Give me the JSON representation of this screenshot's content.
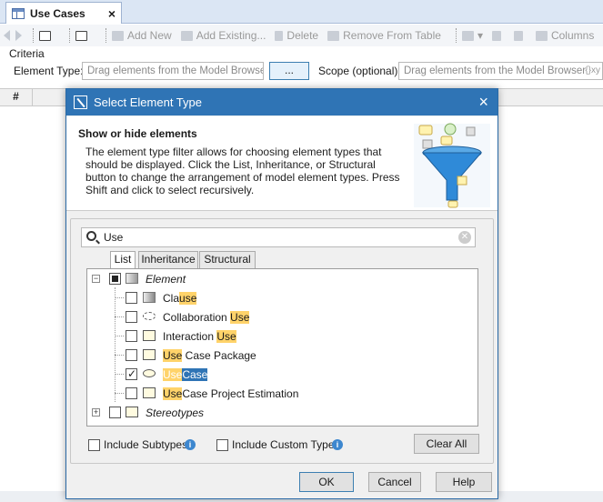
{
  "tab": {
    "title": "Use Cases",
    "close": "×"
  },
  "toolbar": {
    "add_new": "Add New",
    "add_existing": "Add Existing...",
    "delete": "Delete",
    "remove_from_table": "Remove From Table",
    "columns": "Columns"
  },
  "criteria": {
    "label": "Criteria",
    "element_type_label": "Element Type:",
    "element_type_placeholder": "Drag elements from the Model Browser",
    "browse_button": "...",
    "scope_label": "Scope (optional):",
    "scope_placeholder": "Drag elements from the Model Browser",
    "scope_suffix": "{}ху"
  },
  "table": {
    "hash_header": "#"
  },
  "dialog": {
    "title": "Select Element Type",
    "close": "×",
    "banner_title": "Show or hide elements",
    "banner_text": "The element type filter allows for choosing element types that should be displayed. Click the List, Inheritance, or Structural button to change the arrangement of model element types. Press Shift and click to select recursively.",
    "search_value": "Use",
    "tabs": [
      "List",
      "Inheritance",
      "Structural"
    ],
    "tree": [
      {
        "pre": "",
        "hl": "",
        "post": "Element",
        "italic": true
      },
      {
        "pre": "Cla",
        "hl": "use",
        "post": "",
        "italic": false
      },
      {
        "pre": "Collaboration ",
        "hl": "Use",
        "post": "",
        "italic": false
      },
      {
        "pre": "Interaction ",
        "hl": "Use",
        "post": "",
        "italic": false
      },
      {
        "pre": "",
        "hl": "Use",
        "post": " Case Package",
        "italic": false
      },
      {
        "pre": "",
        "hl": "Use",
        "post": "Case",
        "italic": false
      },
      {
        "pre": "",
        "hl": "Use",
        "post": "Case Project Estimation",
        "italic": false
      },
      {
        "pre": "",
        "hl": "",
        "post": "Stereotypes",
        "italic": true
      }
    ],
    "include_subtypes": "Include Subtypes",
    "include_custom_types": "Include Custom Types",
    "clear_all": "Clear All",
    "ok": "OK",
    "cancel": "Cancel",
    "help": "Help"
  }
}
